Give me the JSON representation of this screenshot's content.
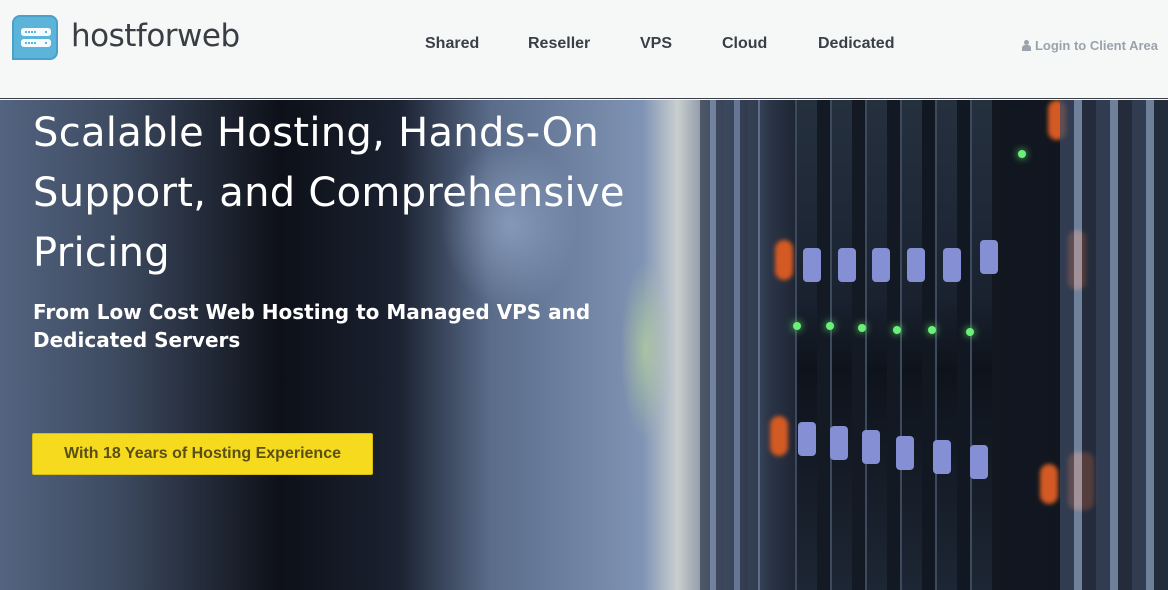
{
  "header": {
    "logo_text": "hostforweb",
    "nav": [
      {
        "label": "Shared"
      },
      {
        "label": "Reseller"
      },
      {
        "label": "VPS"
      },
      {
        "label": "Cloud"
      },
      {
        "label": "Dedicated"
      }
    ],
    "login_label": "Login to Client Area",
    "login_icon": "user-icon"
  },
  "hero": {
    "headline": "Scalable Hosting, Hands-On Support, and Comprehensive Pricing",
    "subheadline": "From Low Cost Web Hosting to Managed VPS and Dedicated Servers",
    "cta_label": "With 18 Years of Hosting Experience",
    "background": "server-rack-photo"
  },
  "colors": {
    "logo_blue": "#5db4d9",
    "cta_yellow": "#f5da1e",
    "nav_text": "#3a3e47",
    "login_text": "#9aa2ab"
  }
}
